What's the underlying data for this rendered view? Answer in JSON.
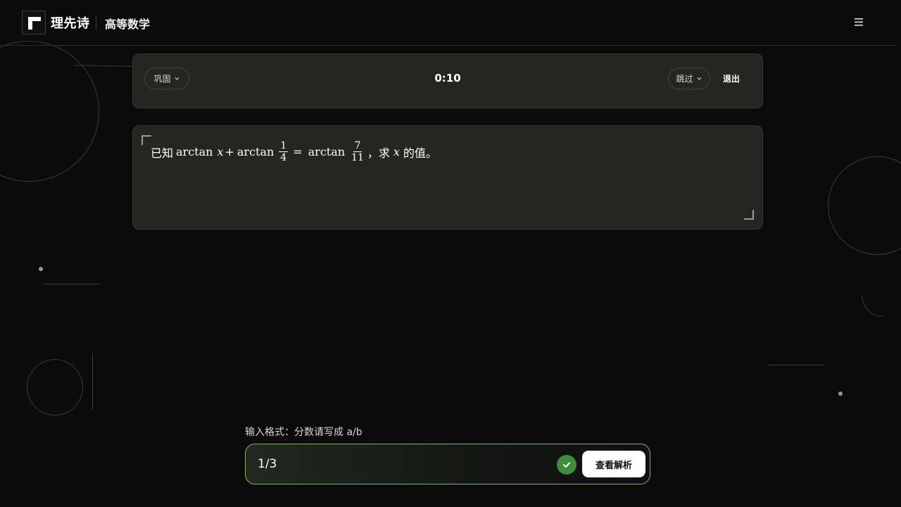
{
  "header": {
    "brand": "理先诗",
    "subject": "高等数学",
    "logo_icon": "logo-icon",
    "menu_icon": "hamburger-menu-icon"
  },
  "toolbar": {
    "mode_label": "巩固",
    "timer": "0:10",
    "skip_label": "跳过",
    "exit_label": "退出"
  },
  "question": {
    "prefix": "已知",
    "fn1": "arctan",
    "var1": "x",
    "plus": "+",
    "fn2": "arctan",
    "frac1_num": "1",
    "frac1_den": "4",
    "eq": "=",
    "fn3": "arctan",
    "frac2_num": "7",
    "frac2_den": "11",
    "mid": "，求",
    "var2": "x",
    "suffix": "的值。"
  },
  "answer": {
    "format_hint": "输入格式：分数请写成 a/b",
    "value": "1/3",
    "status_icon": "check-icon",
    "status_color": "#3f8d3a",
    "solution_label": "查看解析"
  }
}
